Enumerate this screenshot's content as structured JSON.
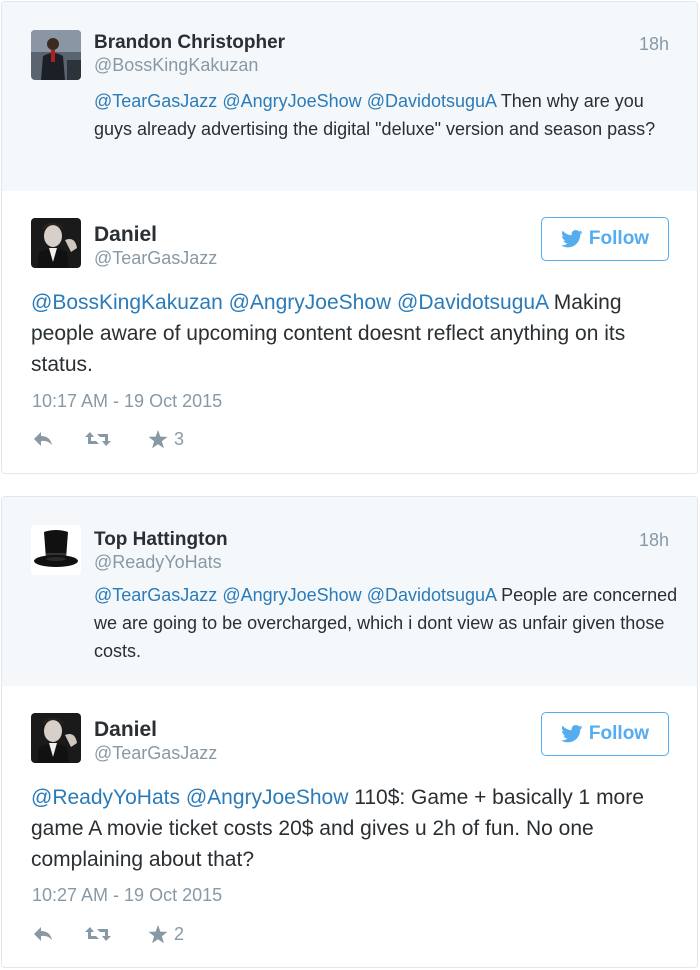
{
  "colors": {
    "link": "#2b7bb9",
    "twitter_blue": "#55acee",
    "muted": "#8899a6",
    "text": "#292f33"
  },
  "threads": [
    {
      "parent": {
        "name": "Brandon Christopher",
        "handle": "@BossKingKakuzan",
        "time": "18h",
        "mentions": [
          "@TearGasJazz",
          "@AngryJoeShow",
          "@DavidotsuguA"
        ],
        "text": " Then why are you guys already advertising the digital \"deluxe\" version and season pass?"
      },
      "reply": {
        "name": "Daniel",
        "handle": "@TearGasJazz",
        "follow_label": "Follow",
        "mentions": [
          "@BossKingKakuzan",
          "@AngryJoeShow",
          "@DavidotsuguA"
        ],
        "text": "Making people aware of upcoming content doesnt reflect anything on its status.",
        "timestamp": "10:17 AM - 19 Oct 2015",
        "favorites": "3"
      }
    },
    {
      "parent": {
        "name": "Top Hattington",
        "handle": "@ReadyYoHats",
        "time": "18h",
        "mentions": [
          "@TearGasJazz",
          "@AngryJoeShow",
          "@DavidotsuguA"
        ],
        "text": "People are concerned we are going to be overcharged, which i dont view as unfair given those costs."
      },
      "reply": {
        "name": "Daniel",
        "handle": "@TearGasJazz",
        "follow_label": "Follow",
        "mentions": [
          "@ReadyYoHats",
          "@AngryJoeShow"
        ],
        "text": "110$: Game + basically 1 more game A movie ticket costs 20$ and gives u 2h of fun. No one complaining about that?",
        "timestamp": "10:27 AM - 19 Oct 2015",
        "favorites": "2"
      }
    }
  ]
}
